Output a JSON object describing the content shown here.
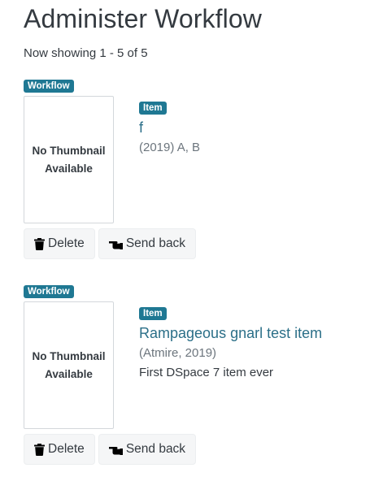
{
  "page": {
    "title": "Administer Workflow",
    "showing": "Now showing 1 - 5 of 5"
  },
  "results": [
    {
      "workflow_badge": "Workflow",
      "thumbnail": {
        "line1": "No Thumbnail",
        "line2": "Available"
      },
      "type_badge": "Item",
      "title": "f",
      "subtitle": "(2019) A, B",
      "abstract": "",
      "delete_label": "Delete",
      "send_back_label": "Send back"
    },
    {
      "workflow_badge": "Workflow",
      "thumbnail": {
        "line1": "No Thumbnail",
        "line2": "Available"
      },
      "type_badge": "Item",
      "title": "Rampageous gnarl test item",
      "subtitle": "(Atmire, 2019)",
      "abstract": "First DSpace 7 item ever",
      "delete_label": "Delete",
      "send_back_label": "Send back"
    }
  ],
  "icons": {
    "delete": "trash-icon",
    "send_back": "hand-point-left-icon"
  },
  "colors": {
    "badge": "#1f7893",
    "link": "#2b6f88",
    "muted": "#6c757d",
    "text": "#343a40"
  }
}
